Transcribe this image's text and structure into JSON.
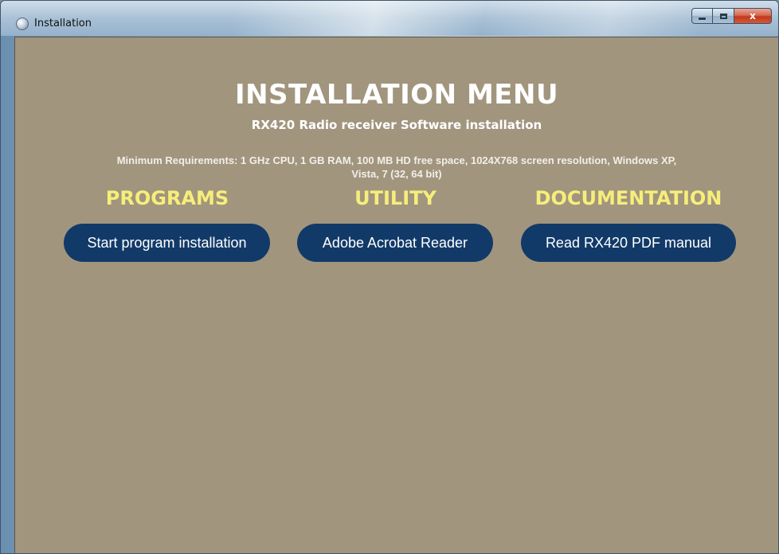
{
  "window": {
    "title": "Installation",
    "caption_buttons": {
      "minimize_icon": "minimize-icon",
      "maximize_icon": "maximize-icon",
      "close_label": "x"
    }
  },
  "menu": {
    "title": "INSTALLATION MENU",
    "subtitle": "RX420 Radio receiver Software installation",
    "requirements_line1": "Minimum Requirements: 1 GHz CPU, 1 GB RAM, 100 MB HD free space, 1024X768 screen resolution, Windows XP,",
    "requirements_line2": "Vista, 7 (32, 64 bit)"
  },
  "sections": [
    {
      "heading": "PROGRAMS",
      "button_label": "Start program installation"
    },
    {
      "heading": "UTILITY",
      "button_label": "Adobe Acrobat Reader"
    },
    {
      "heading": "DOCUMENTATION",
      "button_label": "Read RX420 PDF manual"
    }
  ],
  "colors": {
    "background": "#a1957e",
    "heading_yellow": "#f6ee7a",
    "button_navy": "#123a68",
    "title_white": "#ffffff"
  }
}
